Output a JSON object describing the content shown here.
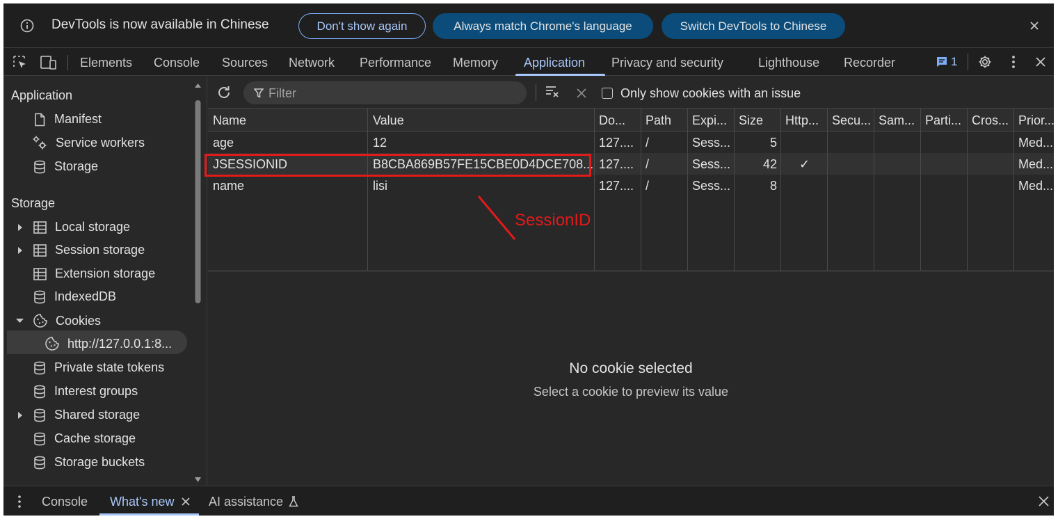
{
  "infobar": {
    "message": "DevTools is now available in Chinese",
    "dont_show": "Don't show again",
    "always_match": "Always match Chrome's language",
    "switch": "Switch DevTools to Chinese"
  },
  "tabs": [
    "Elements",
    "Console",
    "Sources",
    "Network",
    "Performance",
    "Memory",
    "Application",
    "Privacy and security",
    "Lighthouse",
    "Recorder"
  ],
  "active_tab": "Application",
  "issues_count": "1",
  "sidebar": {
    "application_heading": "Application",
    "application_items": [
      "Manifest",
      "Service workers",
      "Storage"
    ],
    "storage_heading": "Storage",
    "storage_items": [
      "Local storage",
      "Session storage",
      "Extension storage",
      "IndexedDB",
      "Cookies",
      "http://127.0.0.1:8...",
      "Private state tokens",
      "Interest groups",
      "Shared storage",
      "Cache storage",
      "Storage buckets"
    ]
  },
  "toolbar": {
    "filter_placeholder": "Filter",
    "only_issues_label": "Only show cookies with an issue"
  },
  "table": {
    "columns": [
      "Name",
      "Value",
      "Do...",
      "Path",
      "Expi...",
      "Size",
      "Http...",
      "Secu...",
      "Sam...",
      "Parti...",
      "Cros...",
      "Prior..."
    ],
    "rows": [
      {
        "name": "age",
        "value": "12",
        "domain": "127....",
        "path": "/",
        "expires": "Sess...",
        "size": "5",
        "http": "",
        "priority": "Med..."
      },
      {
        "name": "JSESSIONID",
        "value": "B8CBA869B57FE15CBE0D4DCE708...",
        "domain": "127....",
        "path": "/",
        "expires": "Sess...",
        "size": "42",
        "http": "✓",
        "priority": "Med..."
      },
      {
        "name": "name",
        "value": "lisi",
        "domain": "127....",
        "path": "/",
        "expires": "Sess...",
        "size": "8",
        "http": "",
        "priority": "Med..."
      }
    ]
  },
  "annotation": "SessionID",
  "annotation_color": "#e21a1a",
  "empty": {
    "title": "No cookie selected",
    "subtitle": "Select a cookie to preview its value"
  },
  "drawer": {
    "tabs": [
      "Console",
      "What's new",
      "AI assistance"
    ]
  },
  "accent": "#a8c7fa"
}
